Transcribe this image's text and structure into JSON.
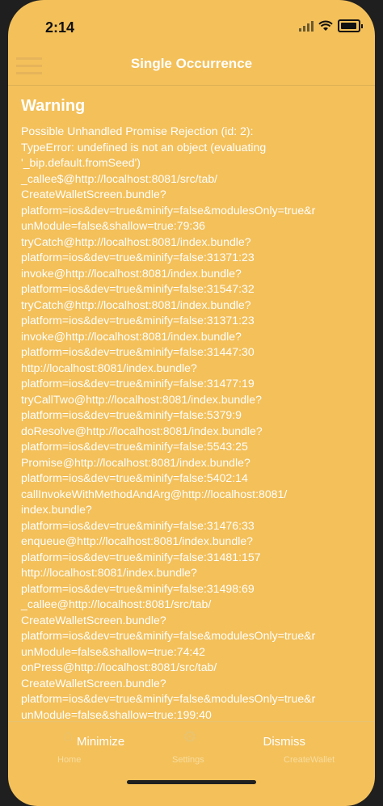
{
  "status_bar": {
    "time": "2:14"
  },
  "header": {
    "title": "Single Occurrence"
  },
  "warning": {
    "title": "Warning",
    "lines": [
      "Possible Unhandled Promise Rejection (id: 2):",
      "TypeError: undefined is not an object (evaluating",
      "'_bip.default.fromSeed')",
      "_callee$@http://localhost:8081/src/tab/",
      "CreateWalletScreen.bundle?",
      "platform=ios&dev=true&minify=false&modulesOnly=true&r",
      "unModule=false&shallow=true:79:36",
      "tryCatch@http://localhost:8081/index.bundle?",
      "platform=ios&dev=true&minify=false:31371:23",
      "invoke@http://localhost:8081/index.bundle?",
      "platform=ios&dev=true&minify=false:31547:32",
      "tryCatch@http://localhost:8081/index.bundle?",
      "platform=ios&dev=true&minify=false:31371:23",
      "invoke@http://localhost:8081/index.bundle?",
      "platform=ios&dev=true&minify=false:31447:30",
      "http://localhost:8081/index.bundle?",
      "platform=ios&dev=true&minify=false:31477:19",
      "tryCallTwo@http://localhost:8081/index.bundle?",
      "platform=ios&dev=true&minify=false:5379:9",
      "doResolve@http://localhost:8081/index.bundle?",
      "platform=ios&dev=true&minify=false:5543:25",
      "Promise@http://localhost:8081/index.bundle?",
      "platform=ios&dev=true&minify=false:5402:14",
      "callInvokeWithMethodAndArg@http://localhost:8081/",
      "index.bundle?",
      "platform=ios&dev=true&minify=false:31476:33",
      "enqueue@http://localhost:8081/index.bundle?",
      "platform=ios&dev=true&minify=false:31481:157",
      "http://localhost:8081/index.bundle?",
      "platform=ios&dev=true&minify=false:31498:69",
      "_callee@http://localhost:8081/src/tab/",
      "CreateWalletScreen.bundle?",
      "platform=ios&dev=true&minify=false&modulesOnly=true&r",
      "unModule=false&shallow=true:74:42",
      "onPress@http://localhost:8081/src/tab/",
      "CreateWalletScreen.bundle?",
      "platform=ios&dev=true&minify=false&modulesOnly=true&r",
      "unModule=false&shallow=true:199:40"
    ]
  },
  "actions": {
    "minimize_label": "Minimize",
    "dismiss_label": "Dismiss"
  },
  "underlying_tabs": [
    {
      "label": "Home",
      "icon": "home-icon"
    },
    {
      "label": "Settings",
      "icon": "gear-icon"
    },
    {
      "label": "CreateWallet",
      "icon": "wallet-icon"
    }
  ]
}
